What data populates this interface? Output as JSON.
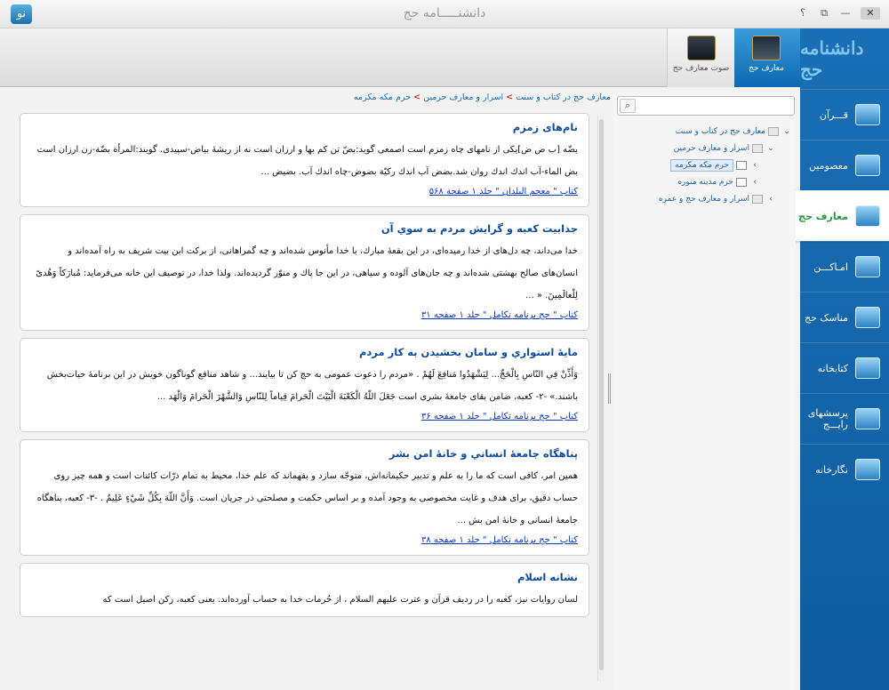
{
  "window": {
    "title": "دانشنـــــامه حج",
    "logo_glyph": "نو",
    "buttons": [
      "؟",
      "⧉",
      "—",
      "✕"
    ]
  },
  "sidebar": {
    "logo": "دانشنامه حج",
    "items": [
      {
        "label": "قـــرآن",
        "icon": "quran-icon"
      },
      {
        "label": "معصومین",
        "icon": "masoumin-icon"
      },
      {
        "label": "معارف حج",
        "icon": "kaaba-icon",
        "active": true
      },
      {
        "label": "امـاکـــن",
        "icon": "places-icon"
      },
      {
        "label": "مناسک حج",
        "icon": "pilgrim-icon"
      },
      {
        "label": "کتابخانه",
        "icon": "library-icon"
      },
      {
        "label": "پرسشهای رایـــج",
        "icon": "faq-icon"
      },
      {
        "label": "نگارخانه",
        "icon": "gallery-icon"
      }
    ]
  },
  "header_tabs": [
    {
      "label": "معارف حج",
      "active": true
    },
    {
      "label": "صوت معارف حج",
      "active": false
    }
  ],
  "breadcrumb": [
    "معارف حج در کتاب و سنت",
    "اسرار و معارف حرمین",
    "حرم مکه مکرمه"
  ],
  "search": {
    "placeholder": "",
    "button": "⌕"
  },
  "tree": [
    {
      "label": "معارف حج در کتاب و سنت",
      "level": 0,
      "caret": "⌄"
    },
    {
      "label": "اسرار و معارف حرمین",
      "level": 1,
      "caret": "⌄"
    },
    {
      "label": "حرم مکه مکرمه",
      "level": 2,
      "caret": "›",
      "selected": true
    },
    {
      "label": "حرم مدینه منوره",
      "level": 2,
      "caret": "›"
    },
    {
      "label": "اسرار و معارف حج و عمره",
      "level": 1,
      "caret": "›"
    }
  ],
  "cards": [
    {
      "title": "نام‌های زمزم",
      "body": "بضّه [ب ض ض]يكى از نامهاى چاه زمزم است اصمعى گويد:بضّ تن كم بها و ارزان است نه از ريشهٔ بياض-سپيدى. گويند:المرأة بضّة-زن ارزان است بض الماء-آب اندك اندك روان شد.بضض آب اندك ركيّة بضوض-چاه اندك آب. بضيض ...",
      "source": "كتاب \" معجم البلدان \" جلد ١ صفحه ۵۶٨"
    },
    {
      "title": "جذابيت کعبه و گرايش مردم به سوي آن",
      "body": "خدا مى‌داند، چه دل‌هاى از خدا رميده‌اى، در اين بقعهٔ مبارك، با خدا مأنوس شده‌اند و چه گمراهانى، از بركت اين بيت شريف به راه آمده‌اند و انسان‌هاى صالح بهشتى شده‌اند و چه جان‌هاى آلوده و سياهى، در اين جا پاك و منوّر گرديده‌اند. ولذا خدا، در توصيف اين خانه مى‌فرمايد: مُبارَكاً وَهُدىً لِلْعالَمِينَ. « ...",
      "source": "كتاب \" حج برنامه تكامل \" جلد ١ صفحه ٣١"
    },
    {
      "title": "مايهٔ استواري و سامان بخشيدن به کار مردم",
      "body": "وَأَذِّنْ فِي النّاسِ بِالْحَجِّ... لِيَشْهَدُوا مَنافِعَ لَهُمْ . «مردم را دعوت عمومى به حج كن تا بيايند... و شاهد منافع گوناگون خويش در اين برنامهٔ حيات‌بخش باشند.» -٢- كعبه، ضامن بقاى جامعهٔ بشرى است جَعَلَ اللّهُ الْكَعْبَةَ الْبَيْتَ الْحَرامَ قِياماً لِلنّاسِ وَالشَّهْرَ الْحَرامَ وَالْهَد ...",
      "source": "كتاب \" حج برنامه تكامل \" جلد ١ صفحه ٣۶"
    },
    {
      "title": "پناهگاه جامعهٔ انساني و خانهٔ امن بشر",
      "body": "همين امر، كافى است كه ما را به علم و تدبير حكيمانه‌اش، متوجّه سازد و بفهماند كه علم خدا، محيط به تمام ذرّات كائنات است و همه چيز روى حساب دقيق، براى هدف و غايت مخصوصى به وجود آمده و بر اساس حكمت و مصلحتى در جريان است. وَأَنَّ اللّهَ بِكُلِّ شَيْءٍ عَلِيمٌ . -٣- كعبه، پناهگاه جامعهٔ انسانى و خانهٔ امن بش ...",
      "source": "كتاب \" حج برنامه تكامل \" جلد ١ صفحه ٣٨"
    },
    {
      "title": "نشانه اسلام",
      "body": "لسان روايات نيز، كعبه را در رديف قرآن و عترت عليهم السلام ، از حُرمات خدا به حساب آورده‌اند. يعنى كعبه، ركن اصيل است كه",
      "source": ""
    }
  ]
}
